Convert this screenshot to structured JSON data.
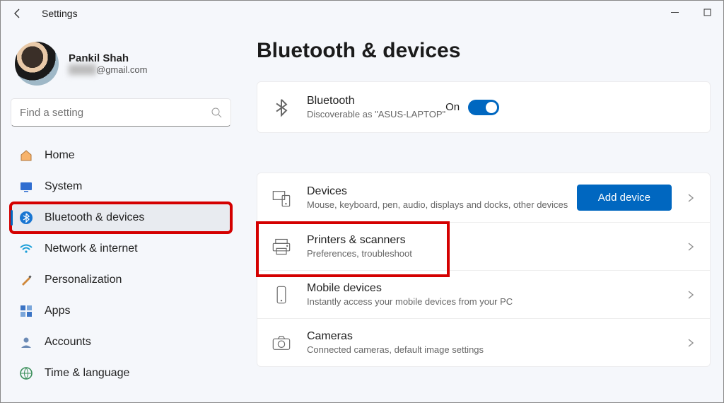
{
  "window": {
    "title": "Settings"
  },
  "user": {
    "name": "Pankil Shah",
    "email_suffix": "@gmail.com"
  },
  "search": {
    "placeholder": "Find a setting"
  },
  "sidebar": {
    "items": [
      {
        "label": "Home"
      },
      {
        "label": "System"
      },
      {
        "label": "Bluetooth & devices"
      },
      {
        "label": "Network & internet"
      },
      {
        "label": "Personalization"
      },
      {
        "label": "Apps"
      },
      {
        "label": "Accounts"
      },
      {
        "label": "Time & language"
      }
    ]
  },
  "page": {
    "title": "Bluetooth & devices",
    "bluetooth": {
      "title": "Bluetooth",
      "subtitle": "Discoverable as \"ASUS-LAPTOP\"",
      "state_label": "On"
    },
    "devices": {
      "title": "Devices",
      "subtitle": "Mouse, keyboard, pen, audio, displays and docks, other devices",
      "button": "Add device"
    },
    "printers": {
      "title": "Printers & scanners",
      "subtitle": "Preferences, troubleshoot"
    },
    "mobile": {
      "title": "Mobile devices",
      "subtitle": "Instantly access your mobile devices from your PC"
    },
    "cameras": {
      "title": "Cameras",
      "subtitle": "Connected cameras, default image settings"
    }
  }
}
